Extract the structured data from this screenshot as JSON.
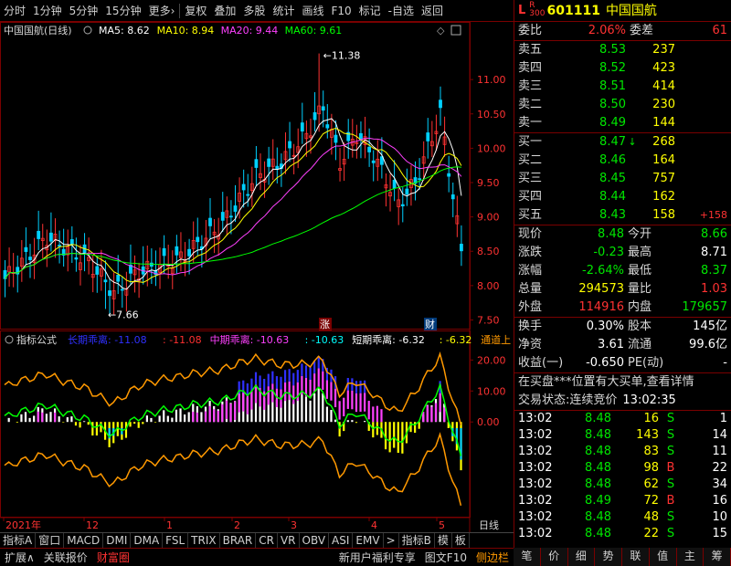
{
  "toolbar": {
    "items": [
      "分时",
      "1分钟",
      "5分钟",
      "15分钟",
      "更多›",
      "复权",
      "叠加",
      "多股",
      "统计",
      "画线",
      "F10",
      "标记",
      "-自选",
      "返回"
    ]
  },
  "chart": {
    "title": "中国国航(日线)",
    "ma_labels": [
      {
        "text": "MA5: 8.62",
        "color": "#ffffff"
      },
      {
        "text": "MA10: 8.94",
        "color": "#ffff00"
      },
      {
        "text": "MA20: 9.44",
        "color": "#ff40ff"
      },
      {
        "text": "MA60: 9.61",
        "color": "#00ff00"
      }
    ],
    "price_ticks": [
      "11.00",
      "10.50",
      "10.00",
      "9.50",
      "9.00",
      "8.50",
      "8.00",
      "7.50"
    ],
    "high_mark": "11.38",
    "low_mark": "7.66",
    "event_zhang": "涨",
    "event_cai": "财",
    "date_ticks": [
      "2021年",
      "12",
      "1",
      "2",
      "3",
      "4",
      "5"
    ],
    "date_label": "日线"
  },
  "indicator": {
    "name": "指标公式",
    "items": [
      {
        "text": "长期乖离: -11.08",
        "color": "#3030ff"
      },
      {
        "text": ": -11.08",
        "color": "#ff3030"
      },
      {
        "text": "中期乖离: -10.63",
        "color": "#ff40ff"
      },
      {
        "text": ": -10.63",
        "color": "#00ffff"
      },
      {
        "text": "短期乖离: -6.32",
        "color": "#ffffff"
      },
      {
        "text": ": -6.32",
        "color": "#ffff00"
      },
      {
        "text": "通道上",
        "color": "#ff9900"
      }
    ],
    "ticks": [
      "20.00",
      "10.00",
      "0.00"
    ]
  },
  "tabs": [
    "指标A",
    "窗口",
    "MACD",
    "DMI",
    "DMA",
    "FSL",
    "TRIX",
    "BRAR",
    "CR",
    "VR",
    "OBV",
    "ASI",
    "EMV",
    ">",
    "指标B",
    "模",
    "板"
  ],
  "stock": {
    "flag": "L",
    "flag2": "R",
    "flag3": "300",
    "code": "601111",
    "name": "中国国航"
  },
  "quote": {
    "weibi_label": "委比",
    "weibi": "2.06%",
    "weicha_label": "委差",
    "weicha": "61",
    "sells": [
      {
        "label": "卖五",
        "price": "8.53",
        "vol": "237"
      },
      {
        "label": "卖四",
        "price": "8.52",
        "vol": "423"
      },
      {
        "label": "卖三",
        "price": "8.51",
        "vol": "414"
      },
      {
        "label": "卖二",
        "price": "8.50",
        "vol": "230"
      },
      {
        "label": "卖一",
        "price": "8.49",
        "vol": "144"
      }
    ],
    "buys": [
      {
        "label": "买一",
        "price": "8.47",
        "vol": "268",
        "arrow": "↓",
        "extra": ""
      },
      {
        "label": "买二",
        "price": "8.46",
        "vol": "164",
        "arrow": "",
        "extra": ""
      },
      {
        "label": "买三",
        "price": "8.45",
        "vol": "757",
        "arrow": "",
        "extra": ""
      },
      {
        "label": "买四",
        "price": "8.44",
        "vol": "162",
        "arrow": "",
        "extra": ""
      },
      {
        "label": "买五",
        "price": "8.43",
        "vol": "158",
        "arrow": "",
        "extra": "+158"
      }
    ],
    "stats": [
      {
        "l1": "现价",
        "v1": "8.48",
        "c1": "#00e600",
        "l2": "今开",
        "v2": "8.66",
        "c2": "#00e600"
      },
      {
        "l1": "涨跌",
        "v1": "-0.23",
        "c1": "#00e600",
        "l2": "最高",
        "v2": "8.71",
        "c2": "#ffffff"
      },
      {
        "l1": "涨幅",
        "v1": "-2.64%",
        "c1": "#00e600",
        "l2": "最低",
        "v2": "8.37",
        "c2": "#00e600"
      },
      {
        "l1": "总量",
        "v1": "294573",
        "c1": "#ffff00",
        "l2": "量比",
        "v2": "1.03",
        "c2": "#ff3232"
      },
      {
        "l1": "外盘",
        "v1": "114916",
        "c1": "#ff3232",
        "l2": "内盘",
        "v2": "179657",
        "c2": "#00e600"
      }
    ],
    "stats2": [
      {
        "l1": "换手",
        "v1": "0.30%",
        "l2": "股本",
        "v2": "145亿"
      },
      {
        "l1": "净资",
        "v1": "3.61",
        "l2": "流通",
        "v2": "99.6亿"
      },
      {
        "l1": "收益(一)",
        "v1": "-0.650",
        "l2": "PE(动)",
        "v2": "-"
      }
    ],
    "news": "在买盘***位置有大买单,查看详情",
    "status_label": "交易状态:",
    "status": "连续竞价",
    "status_time": "13:02:35"
  },
  "ticks": [
    {
      "t": "13:02",
      "p": "8.48",
      "v": "16",
      "s": "S",
      "n": "1"
    },
    {
      "t": "13:02",
      "p": "8.48",
      "v": "143",
      "s": "S",
      "n": "14"
    },
    {
      "t": "13:02",
      "p": "8.48",
      "v": "83",
      "s": "S",
      "n": "11"
    },
    {
      "t": "13:02",
      "p": "8.48",
      "v": "98",
      "s": "B",
      "n": "22"
    },
    {
      "t": "13:02",
      "p": "8.48",
      "v": "62",
      "s": "S",
      "n": "34"
    },
    {
      "t": "13:02",
      "p": "8.49",
      "v": "72",
      "s": "B",
      "n": "16"
    },
    {
      "t": "13:02",
      "p": "8.48",
      "v": "48",
      "s": "S",
      "n": "10"
    },
    {
      "t": "13:02",
      "p": "8.48",
      "v": "22",
      "s": "S",
      "n": "15"
    }
  ],
  "bottom": {
    "left": [
      "扩展∧",
      "关联报价",
      "财富圈"
    ],
    "right": [
      "新用户福利专享",
      "图文F10",
      "侧边栏"
    ]
  },
  "right_tabs": [
    "笔",
    "价",
    "细",
    "势",
    "联",
    "值",
    "主",
    "筹"
  ],
  "colors": {
    "up": "#ff3232",
    "down": "#00e600",
    "frame": "#7a0000"
  }
}
